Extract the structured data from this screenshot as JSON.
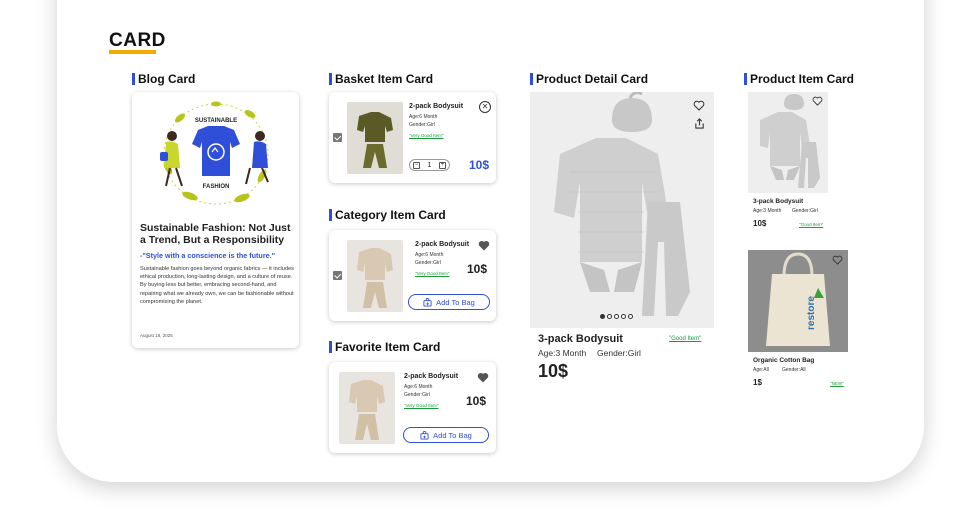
{
  "page": {
    "title": "CARD"
  },
  "sections": {
    "blog": "Blog Card",
    "basket": "Basket Item Card",
    "category": "Category Item Card",
    "favorite": "Favorite Item Card",
    "product_detail": "Product Detail Card",
    "product_item": "Product Item Card"
  },
  "blog_card": {
    "badge_top": "SUSTAINABLE",
    "badge_bottom": "FASHION",
    "title": "Sustainable Fashion: Not Just a Trend, But a Responsibility",
    "quote": "-\"Style with a conscience is the future.\"",
    "body": "Sustainable fashion goes beyond organic fabrics — it includes ethical production, long-lasting design, and a culture of reuse. By buying less but better, embracing second-hand, and repairing what we already own, we can be fashionable without compromising the planet.",
    "date": "August 18, 2025"
  },
  "basket_card": {
    "name": "2-pack Bodysuit",
    "age": "Age:6 Month",
    "gender": "Gender:Girl",
    "tag": "\"Very Good Item\"",
    "qty": "1",
    "price": "10$"
  },
  "category_card": {
    "name": "2-pack Bodysuit",
    "age": "Age:6 Month",
    "gender": "Gender:Girl",
    "tag": "\"Very Good Item\"",
    "price": "10$",
    "button": "Add To Bag"
  },
  "favorite_card": {
    "name": "2-pack Bodysuit",
    "age": "Age:6 Month",
    "gender": "Gender:Girl",
    "tag": "\"Very Good Item\"",
    "price": "10$",
    "button": "Add To Bag"
  },
  "detail_card": {
    "name": "3-pack Bodysuit",
    "tag": "\"Good Item\"",
    "age": "Age:3 Month",
    "gender": "Gender:Girl",
    "price": "10$",
    "slides": 5,
    "active_slide": 0
  },
  "product_items": [
    {
      "name": "3-pack Bodysuit",
      "age": "Age:3 Month",
      "gender": "Gender:Girl",
      "price": "10$",
      "tag": "\"Good Item\""
    },
    {
      "name": "Organic Cotton Bag",
      "age": "Age:All",
      "gender": "Gender:All",
      "price": "1$",
      "tag": "\"NEW\"",
      "bag_print": "restore"
    }
  ],
  "colors": {
    "accent": "#2f4fd8",
    "title_underline": "#f2a900",
    "good_tag": "#1a9a3a"
  }
}
